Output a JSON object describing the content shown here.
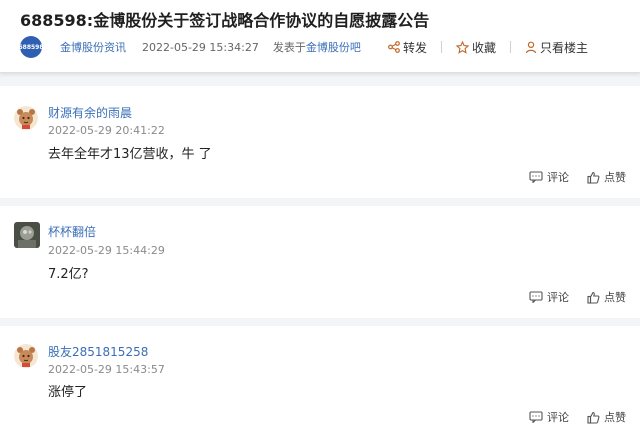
{
  "post": {
    "title": "688598:金博股份关于签订战略合作协议的自愿披露公告",
    "logo_text": "688598",
    "source_name": "金博股份资讯",
    "date": "2022-05-29 15:34:27",
    "posted_prefix": "发表于",
    "posted_link": "金博股份吧"
  },
  "actions": {
    "share": "转发",
    "favorite": "收藏",
    "only_author": "只看楼主"
  },
  "comments": [
    {
      "username": "财源有余的雨晨",
      "time": "2022-05-29 20:41:22",
      "text": "去年全年才13亿营收，牛  了",
      "reply_label": "评论",
      "like_label": "点赞",
      "avatar_icon": "cartoon-avatar-icon"
    },
    {
      "username": "杯杯翻倍",
      "time": "2022-05-29 15:44:29",
      "text": "7.2亿?",
      "reply_label": "评论",
      "like_label": "点赞",
      "avatar_icon": "photo-avatar-icon"
    },
    {
      "username": "股友2851815258",
      "time": "2022-05-29 15:43:57",
      "text": "涨停了",
      "reply_label": "评论",
      "like_label": "点赞",
      "avatar_icon": "cartoon-avatar-icon"
    }
  ],
  "colors": {
    "link": "#3a6fb8",
    "logo_bg": "#2f5fb3",
    "page_bg": "#f3f4f6"
  }
}
